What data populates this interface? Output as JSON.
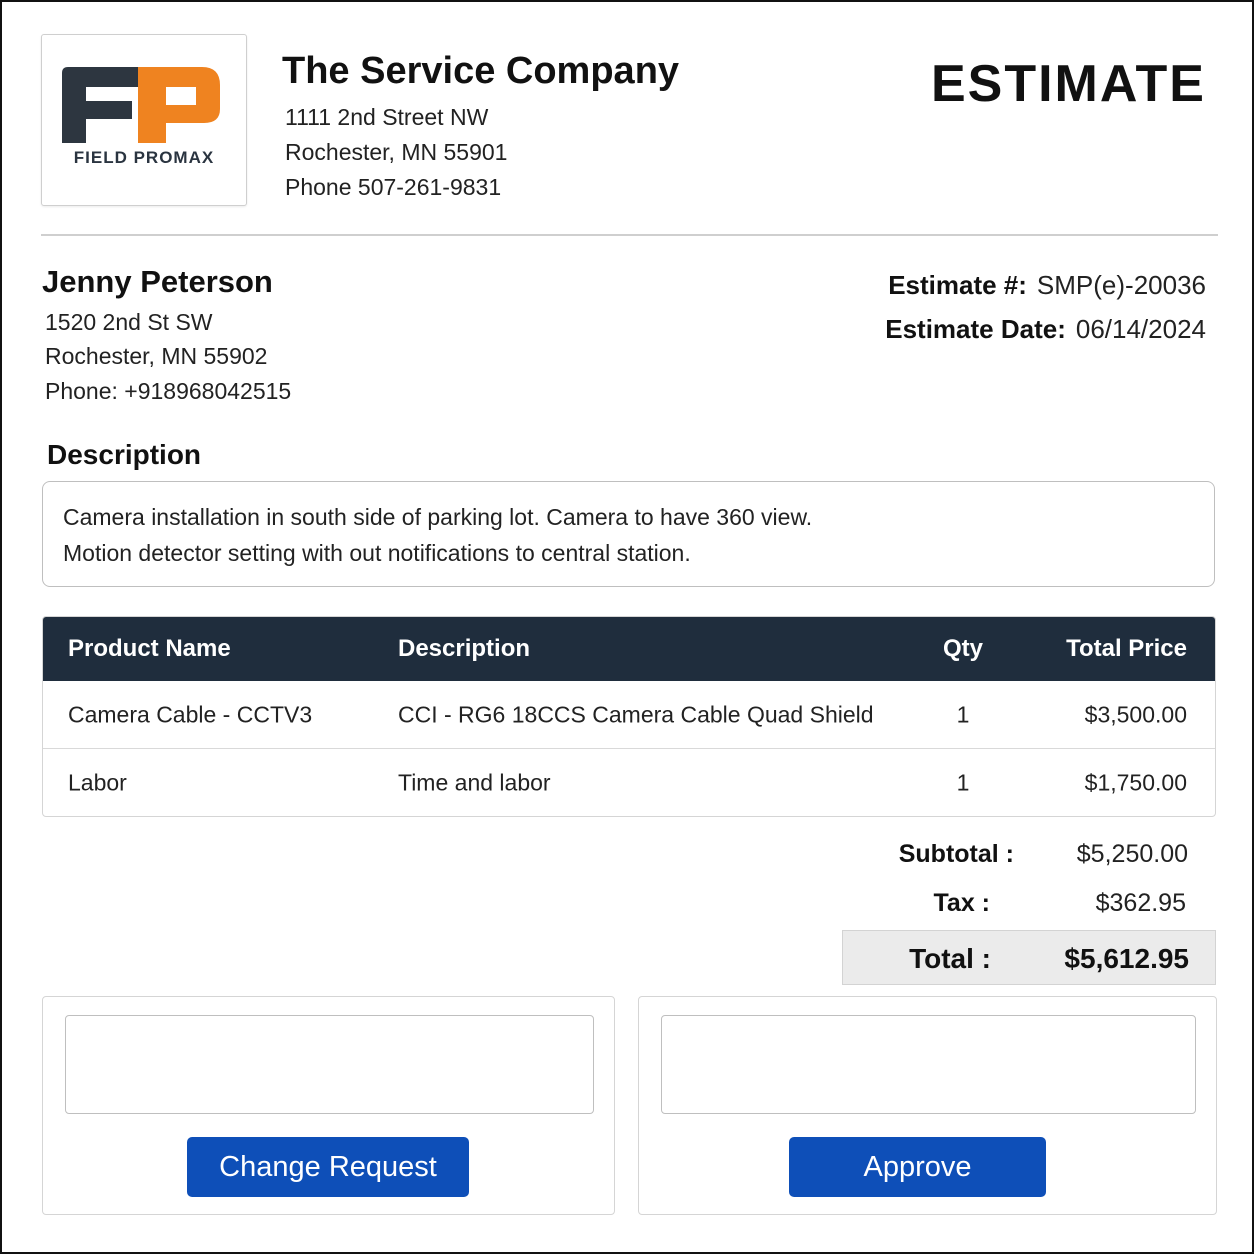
{
  "logo": {
    "text": "FIELD PROMAX",
    "colors": {
      "dark": "#2d3640",
      "orange": "#ef8320"
    }
  },
  "company": {
    "name": "The Service Company",
    "address_line1": "1111 2nd Street NW",
    "address_line2": "Rochester, MN 55901",
    "phone": "Phone 507-261-9831"
  },
  "document": {
    "title": "ESTIMATE"
  },
  "customer": {
    "name": "Jenny Peterson",
    "address_line1": "1520 2nd St SW",
    "address_line2": "Rochester, MN 55902",
    "phone": "Phone: +918968042515"
  },
  "estimate_meta": {
    "number_label": "Estimate #:",
    "number": "SMP(e)-20036",
    "date_label": "Estimate Date:",
    "date": "06/14/2024"
  },
  "description": {
    "heading": "Description",
    "lines": [
      "Camera installation in south side of parking lot. Camera to have 360 view.",
      "Motion detector setting with out notifications to central station."
    ]
  },
  "items_table": {
    "columns": [
      "Product Name",
      "Description",
      "Qty",
      "Total Price"
    ],
    "header_color": "#1f2d3d",
    "rows": [
      {
        "product": "Camera Cable - CCTV3",
        "description": "CCI - RG6 18CCS Camera Cable Quad Shield",
        "qty": "1",
        "price": "$3,500.00"
      },
      {
        "product": "Labor",
        "description": "Time and labor",
        "qty": "1",
        "price": "$1,750.00"
      }
    ]
  },
  "totals": {
    "subtotal_label": "Subtotal :",
    "subtotal": "$5,250.00",
    "tax_label": "Tax :",
    "tax": "$362.95",
    "total_label": "Total :",
    "total": "$5,612.95"
  },
  "actions": {
    "change_request_label": "Change Request",
    "approve_label": "Approve",
    "button_color": "#0e4fb8"
  }
}
